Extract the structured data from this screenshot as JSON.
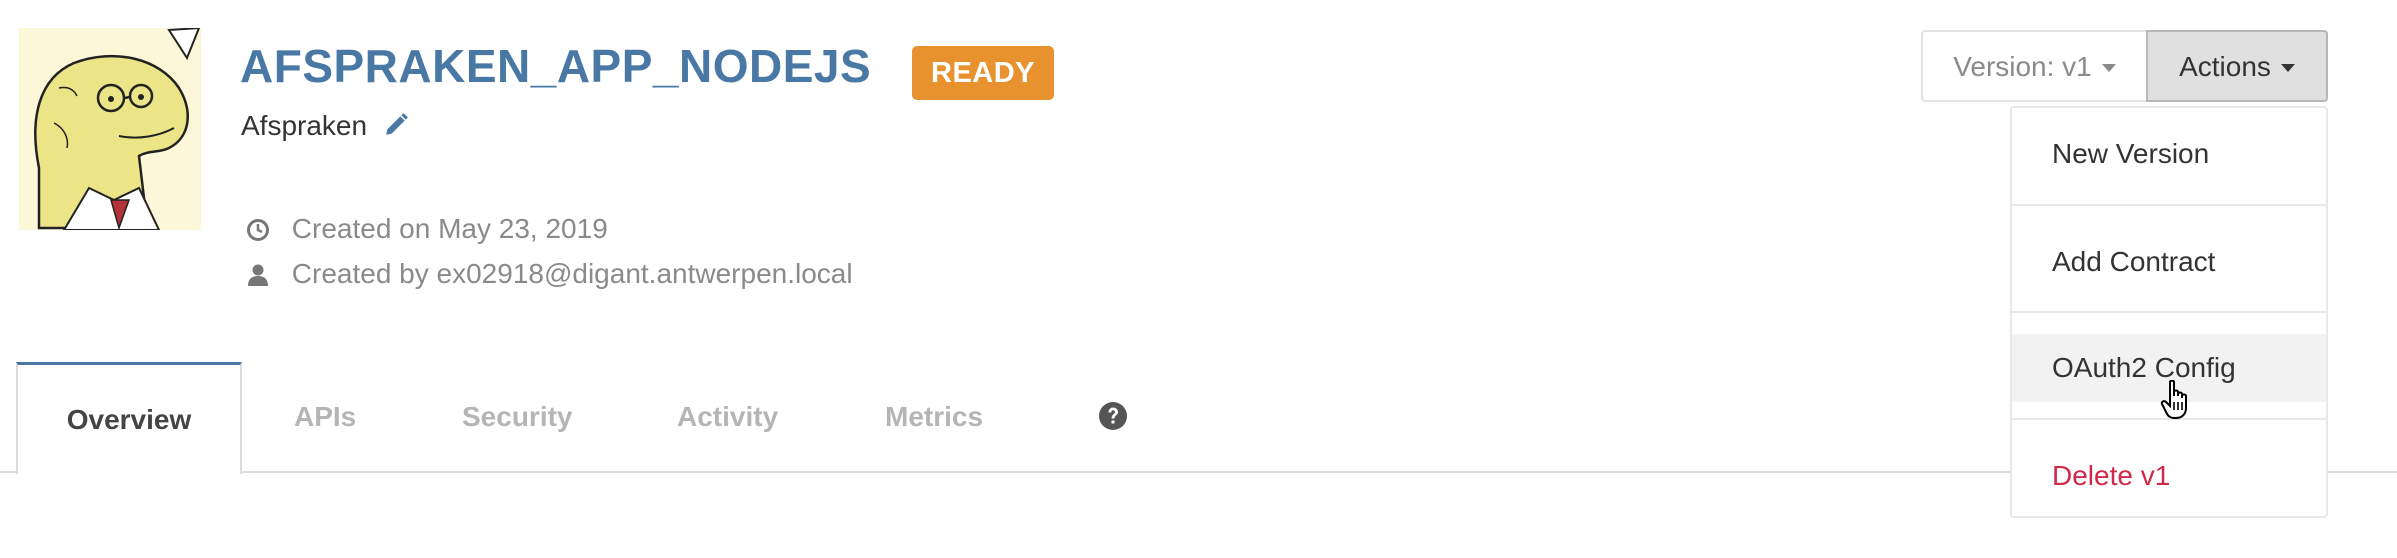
{
  "app": {
    "name": "AFSPRAKEN_APP_NODEJS",
    "status": "READY",
    "description": "Afspraken",
    "created_on": "Created on May 23, 2019",
    "created_by": "Created by ex02918@digant.antwerpen.local"
  },
  "tabs": [
    {
      "label": "Overview",
      "active": true
    },
    {
      "label": "APIs"
    },
    {
      "label": "Security"
    },
    {
      "label": "Activity"
    },
    {
      "label": "Metrics"
    }
  ],
  "version_button": {
    "label": "Version: v1"
  },
  "actions_button": {
    "label": "Actions"
  },
  "actions_menu": [
    {
      "label": "New Version"
    },
    {
      "label": "Add Contract"
    },
    {
      "label": "OAuth2 Config",
      "hovered": true
    },
    {
      "label": "Delete v1",
      "danger": true
    }
  ],
  "colors": {
    "title": "#4a78a5",
    "badge": "#e8912f",
    "danger": "#d2284a",
    "muted": "#8a8a8a"
  },
  "icons": [
    "edit-pencil-icon",
    "clock-icon",
    "user-icon",
    "help-icon",
    "caret-down-icon",
    "hand-cursor-icon"
  ]
}
